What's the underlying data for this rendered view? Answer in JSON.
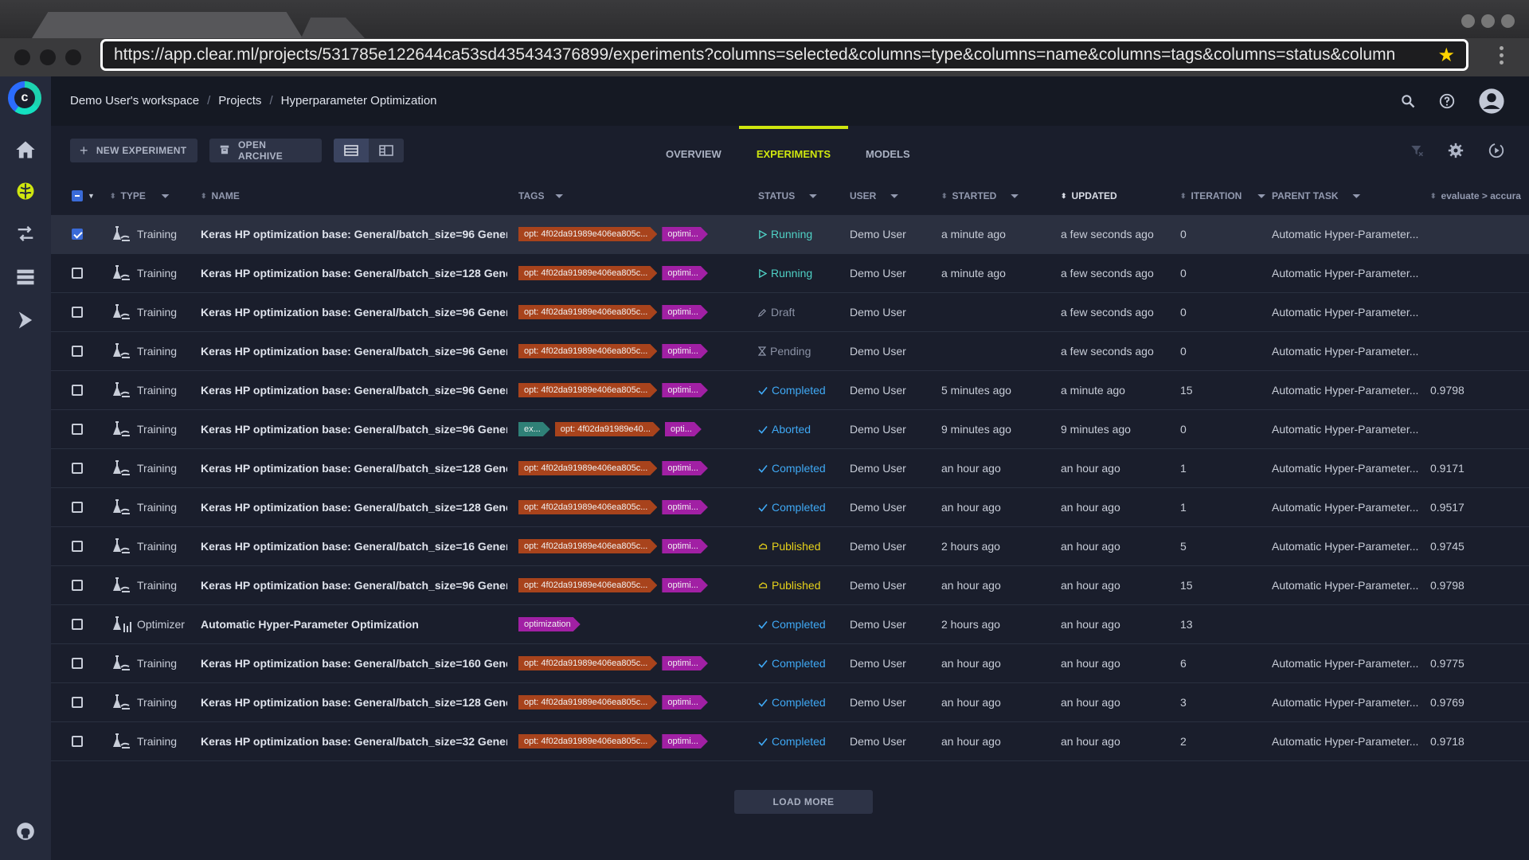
{
  "browser": {
    "url": "https://app.clear.ml/projects/531785e122644ca53sd435434376899/experiments?columns=selected&columns=type&columns=name&columns=tags&columns=status&column"
  },
  "header": {
    "breadcrumb": [
      "Demo User's workspace",
      "Projects",
      "Hyperparameter Optimization"
    ]
  },
  "toolbar": {
    "new_experiment": "NEW EXPERIMENT",
    "open_archive": "OPEN ARCHIVE",
    "tabs": [
      "OVERVIEW",
      "EXPERIMENTS",
      "MODELS"
    ],
    "active_tab": "EXPERIMENTS"
  },
  "columns": {
    "type": "TYPE",
    "name": "NAME",
    "tags": "TAGS",
    "status": "STATUS",
    "user": "USER",
    "started": "STARTED",
    "updated": "UPDATED",
    "iteration": "ITERATION",
    "parent": "PARENT TASK",
    "metric": "evaluate > accura"
  },
  "rows": [
    {
      "selected": true,
      "type": "Training",
      "name": "Keras HP optimization base: General/batch_size=96 Gener...",
      "tags": [
        {
          "t": "opt: 4f02da91989e406ea805c...",
          "k": "opt"
        },
        {
          "t": "optimi...",
          "k": "optimi"
        }
      ],
      "status": "Running",
      "user": "Demo User",
      "started": "a minute ago",
      "updated": "a few seconds ago",
      "iteration": "0",
      "parent": "Automatic Hyper-Parameter...",
      "metric": ""
    },
    {
      "selected": false,
      "type": "Training",
      "name": "Keras HP optimization base: General/batch_size=128 Gene...",
      "tags": [
        {
          "t": "opt: 4f02da91989e406ea805c...",
          "k": "opt"
        },
        {
          "t": "optimi...",
          "k": "optimi"
        }
      ],
      "status": "Running",
      "user": "Demo User",
      "started": "a minute ago",
      "updated": "a few seconds ago",
      "iteration": "0",
      "parent": "Automatic Hyper-Parameter...",
      "metric": ""
    },
    {
      "selected": false,
      "type": "Training",
      "name": "Keras HP optimization base: General/batch_size=96 Gener...",
      "tags": [
        {
          "t": "opt: 4f02da91989e406ea805c...",
          "k": "opt"
        },
        {
          "t": "optimi...",
          "k": "optimi"
        }
      ],
      "status": "Draft",
      "user": "Demo User",
      "started": "",
      "updated": "a few seconds ago",
      "iteration": "0",
      "parent": "Automatic Hyper-Parameter...",
      "metric": ""
    },
    {
      "selected": false,
      "type": "Training",
      "name": "Keras HP optimization base: General/batch_size=96 Gener...",
      "tags": [
        {
          "t": "opt: 4f02da91989e406ea805c...",
          "k": "opt"
        },
        {
          "t": "optimi...",
          "k": "optimi"
        }
      ],
      "status": "Pending",
      "user": "Demo User",
      "started": "",
      "updated": "a few seconds ago",
      "iteration": "0",
      "parent": "Automatic Hyper-Parameter...",
      "metric": ""
    },
    {
      "selected": false,
      "type": "Training",
      "name": "Keras HP optimization base: General/batch_size=96 Gener...",
      "tags": [
        {
          "t": "opt: 4f02da91989e406ea805c...",
          "k": "opt"
        },
        {
          "t": "optimi...",
          "k": "optimi"
        }
      ],
      "status": "Completed",
      "user": "Demo User",
      "started": "5 minutes ago",
      "updated": "a minute ago",
      "iteration": "15",
      "parent": "Automatic Hyper-Parameter...",
      "metric": "0.9798"
    },
    {
      "selected": false,
      "type": "Training",
      "name": "Keras HP optimization base: General/batch_size=96 Gener...",
      "tags": [
        {
          "t": "ex...",
          "k": "ex"
        },
        {
          "t": "opt: 4f02da91989e40...",
          "k": "opt"
        },
        {
          "t": "opti...",
          "k": "optimi"
        }
      ],
      "status": "Aborted",
      "user": "Demo User",
      "started": "9 minutes ago",
      "updated": "9 minutes ago",
      "iteration": "0",
      "parent": "Automatic Hyper-Parameter...",
      "metric": ""
    },
    {
      "selected": false,
      "type": "Training",
      "name": "Keras HP optimization base: General/batch_size=128 Gene...",
      "tags": [
        {
          "t": "opt: 4f02da91989e406ea805c...",
          "k": "opt"
        },
        {
          "t": "optimi...",
          "k": "optimi"
        }
      ],
      "status": "Completed",
      "user": "Demo User",
      "started": "an hour ago",
      "updated": "an hour ago",
      "iteration": "1",
      "parent": "Automatic Hyper-Parameter...",
      "metric": "0.9171"
    },
    {
      "selected": false,
      "type": "Training",
      "name": "Keras HP optimization base: General/batch_size=128 Gene...",
      "tags": [
        {
          "t": "opt: 4f02da91989e406ea805c...",
          "k": "opt"
        },
        {
          "t": "optimi...",
          "k": "optimi"
        }
      ],
      "status": "Completed",
      "user": "Demo User",
      "started": "an hour ago",
      "updated": "an hour ago",
      "iteration": "1",
      "parent": "Automatic Hyper-Parameter...",
      "metric": "0.9517"
    },
    {
      "selected": false,
      "type": "Training",
      "name": "Keras HP optimization base: General/batch_size=16 Gener...",
      "tags": [
        {
          "t": "opt: 4f02da91989e406ea805c...",
          "k": "opt"
        },
        {
          "t": "optimi...",
          "k": "optimi"
        }
      ],
      "status": "Published",
      "user": "Demo User",
      "started": "2 hours ago",
      "updated": "an hour ago",
      "iteration": "5",
      "parent": "Automatic Hyper-Parameter...",
      "metric": "0.9745"
    },
    {
      "selected": false,
      "type": "Training",
      "name": "Keras HP optimization base: General/batch_size=96 Gener...",
      "tags": [
        {
          "t": "opt: 4f02da91989e406ea805c...",
          "k": "opt"
        },
        {
          "t": "optimi...",
          "k": "optimi"
        }
      ],
      "status": "Published",
      "user": "Demo User",
      "started": "an hour ago",
      "updated": "an hour ago",
      "iteration": "15",
      "parent": "Automatic Hyper-Parameter...",
      "metric": "0.9798"
    },
    {
      "selected": false,
      "type": "Optimizer",
      "name": "Automatic Hyper-Parameter Optimization",
      "tags": [
        {
          "t": "optimization",
          "k": "optimi"
        }
      ],
      "status": "Completed",
      "user": "Demo User",
      "started": "2 hours ago",
      "updated": "an hour ago",
      "iteration": "13",
      "parent": "",
      "metric": ""
    },
    {
      "selected": false,
      "type": "Training",
      "name": "Keras HP optimization base: General/batch_size=160 Gene...",
      "tags": [
        {
          "t": "opt: 4f02da91989e406ea805c...",
          "k": "opt"
        },
        {
          "t": "optimi...",
          "k": "optimi"
        }
      ],
      "status": "Completed",
      "user": "Demo User",
      "started": "an hour ago",
      "updated": "an hour ago",
      "iteration": "6",
      "parent": "Automatic Hyper-Parameter...",
      "metric": "0.9775"
    },
    {
      "selected": false,
      "type": "Training",
      "name": "Keras HP optimization base: General/batch_size=128 Gene...",
      "tags": [
        {
          "t": "opt: 4f02da91989e406ea805c...",
          "k": "opt"
        },
        {
          "t": "optimi...",
          "k": "optimi"
        }
      ],
      "status": "Completed",
      "user": "Demo User",
      "started": "an hour ago",
      "updated": "an hour ago",
      "iteration": "3",
      "parent": "Automatic Hyper-Parameter...",
      "metric": "0.9769"
    },
    {
      "selected": false,
      "type": "Training",
      "name": "Keras HP optimization base: General/batch_size=32 Gener...",
      "tags": [
        {
          "t": "opt: 4f02da91989e406ea805c...",
          "k": "opt"
        },
        {
          "t": "optimi...",
          "k": "optimi"
        }
      ],
      "status": "Completed",
      "user": "Demo User",
      "started": "an hour ago",
      "updated": "an hour ago",
      "iteration": "2",
      "parent": "Automatic Hyper-Parameter...",
      "metric": "0.9718"
    }
  ],
  "status_styles": {
    "Running": {
      "color": "#4fd1c5",
      "icon": "play-icon"
    },
    "Draft": {
      "color": "#8b92a5",
      "icon": "pencil-icon"
    },
    "Pending": {
      "color": "#8b92a5",
      "icon": "hourglass-icon"
    },
    "Completed": {
      "color": "#3fa9f5",
      "icon": "check-icon"
    },
    "Aborted": {
      "color": "#3fa9f5",
      "icon": "check-icon"
    },
    "Published": {
      "color": "#e7d21a",
      "icon": "cloud-icon"
    }
  },
  "load_more": "LOAD MORE",
  "colors": {
    "accent": "#cfe60f",
    "tag_opt": "#a8431c",
    "tag_optimi": "#a120a4",
    "tag_ex": "#2f8077"
  }
}
